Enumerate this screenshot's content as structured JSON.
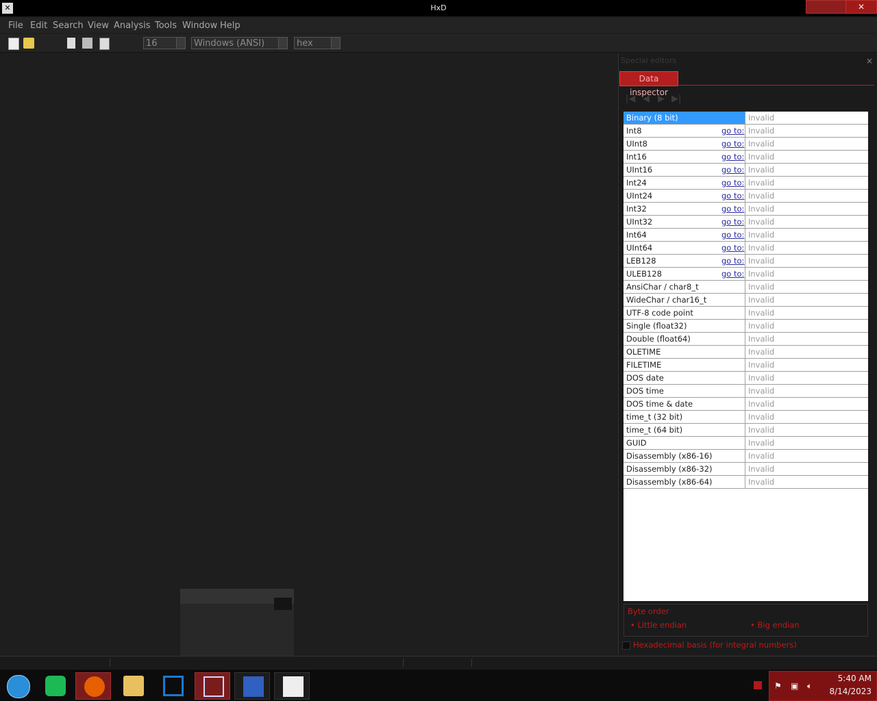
{
  "window": {
    "title": "HxD",
    "close_glyph": "✕"
  },
  "menu": [
    "File",
    "Edit",
    "Search",
    "View",
    "Analysis",
    "Tools",
    "Window",
    "Help"
  ],
  "toolbar": {
    "bytes_per_row": "16",
    "charset": "Windows (ANSI)",
    "offset_base": "hex"
  },
  "panel": {
    "title": "Special editors",
    "close_glyph": "×",
    "tab": "Data inspector",
    "nav": [
      "|◀",
      "◀",
      "▶",
      "▶|"
    ],
    "goto_label": "go to:",
    "rows": [
      {
        "name": "Binary (8 bit)",
        "value": "Invalid",
        "goto": false,
        "selected": true
      },
      {
        "name": "Int8",
        "value": "Invalid",
        "goto": true
      },
      {
        "name": "UInt8",
        "value": "Invalid",
        "goto": true
      },
      {
        "name": "Int16",
        "value": "Invalid",
        "goto": true
      },
      {
        "name": "UInt16",
        "value": "Invalid",
        "goto": true
      },
      {
        "name": "Int24",
        "value": "Invalid",
        "goto": true
      },
      {
        "name": "UInt24",
        "value": "Invalid",
        "goto": true
      },
      {
        "name": "Int32",
        "value": "Invalid",
        "goto": true
      },
      {
        "name": "UInt32",
        "value": "Invalid",
        "goto": true
      },
      {
        "name": "Int64",
        "value": "Invalid",
        "goto": true
      },
      {
        "name": "UInt64",
        "value": "Invalid",
        "goto": true
      },
      {
        "name": "LEB128",
        "value": "Invalid",
        "goto": true
      },
      {
        "name": "ULEB128",
        "value": "Invalid",
        "goto": true
      },
      {
        "name": "AnsiChar / char8_t",
        "value": "Invalid",
        "goto": false
      },
      {
        "name": "WideChar / char16_t",
        "value": "Invalid",
        "goto": false
      },
      {
        "name": "UTF-8 code point",
        "value": "Invalid",
        "goto": false
      },
      {
        "name": "Single (float32)",
        "value": "Invalid",
        "goto": false
      },
      {
        "name": "Double (float64)",
        "value": "Invalid",
        "goto": false
      },
      {
        "name": "OLETIME",
        "value": "Invalid",
        "goto": false
      },
      {
        "name": "FILETIME",
        "value": "Invalid",
        "goto": false
      },
      {
        "name": "DOS date",
        "value": "Invalid",
        "goto": false
      },
      {
        "name": "DOS time",
        "value": "Invalid",
        "goto": false
      },
      {
        "name": "DOS time & date",
        "value": "Invalid",
        "goto": false
      },
      {
        "name": "time_t (32 bit)",
        "value": "Invalid",
        "goto": false
      },
      {
        "name": "time_t (64 bit)",
        "value": "Invalid",
        "goto": false
      },
      {
        "name": "GUID",
        "value": "Invalid",
        "goto": false
      },
      {
        "name": "Disassembly (x86-16)",
        "value": "Invalid",
        "goto": false
      },
      {
        "name": "Disassembly (x86-32)",
        "value": "Invalid",
        "goto": false
      },
      {
        "name": "Disassembly (x86-64)",
        "value": "Invalid",
        "goto": false
      }
    ],
    "byte_order_label": "Byte order",
    "little_endian": "Little endian",
    "big_endian": "Big endian",
    "hex_basis": "Hexadecimal basis (for integral numbers)"
  },
  "taskbar": {
    "apps": [
      "start-orb",
      "chat-app",
      "firefox",
      "file-explorer",
      "virtualbox-manager",
      "virtualbox",
      "sevenzip",
      "hxd"
    ],
    "time": "5:40 AM",
    "date": "8/14/2023"
  },
  "colors": {
    "accent": "#b41e1e",
    "selection": "#3399ff",
    "link": "#2828a0"
  }
}
